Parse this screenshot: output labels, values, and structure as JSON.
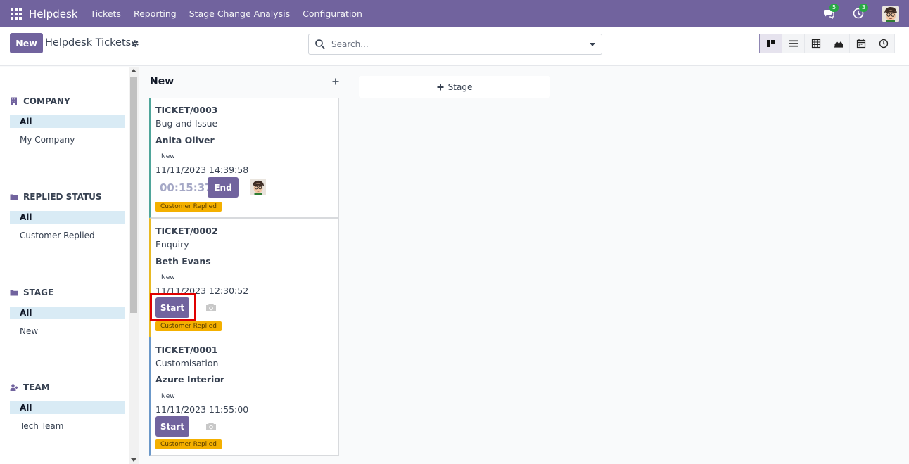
{
  "navbar": {
    "brand": "Helpdesk",
    "menu": [
      "Tickets",
      "Reporting",
      "Stage Change Analysis",
      "Configuration"
    ],
    "messages_badge": "5",
    "activities_badge": "3"
  },
  "control": {
    "new_label": "New",
    "title": "Helpdesk Tickets",
    "search_placeholder": "Search..."
  },
  "sidepanel": {
    "sections": [
      {
        "header": "COMPANY",
        "icon": "building-icon",
        "items": [
          "All",
          "My Company"
        ]
      },
      {
        "header": "REPLIED STATUS",
        "icon": "folder-icon",
        "items": [
          "All",
          "Customer Replied"
        ]
      },
      {
        "header": "STAGE",
        "icon": "folder-icon",
        "items": [
          "All",
          "New"
        ]
      },
      {
        "header": "TEAM",
        "icon": "user-plus-icon",
        "items": [
          "All",
          "Tech Team"
        ]
      }
    ]
  },
  "kanban": {
    "column_title": "New",
    "add_stage_label": "Stage",
    "cards": [
      {
        "ref": "TICKET/0003",
        "subject": "Bug and Issue",
        "partner": "Anita Oliver",
        "stage": "New",
        "date": "11/11/2023 14:39:58",
        "timer": "00:15:37",
        "action": "End",
        "tag": "Customer Replied",
        "color": "#4fa59a"
      },
      {
        "ref": "TICKET/0002",
        "subject": "Enquiry",
        "partner": "Beth Evans",
        "stage": "New",
        "date": "11/11/2023 12:30:52",
        "timer": "",
        "action": "Start",
        "tag": "Customer Replied",
        "color": "#e8b923"
      },
      {
        "ref": "TICKET/0001",
        "subject": "Customisation",
        "partner": "Azure Interior",
        "stage": "New",
        "date": "11/11/2023 11:55:00",
        "timer": "",
        "action": "Start",
        "tag": "Customer Replied",
        "color": "#6b98c9"
      }
    ]
  }
}
